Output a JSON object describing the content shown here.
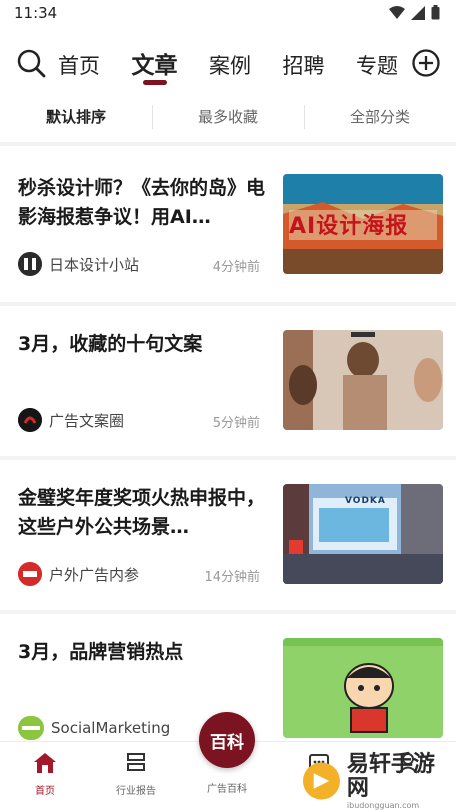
{
  "status": {
    "time": "11:34"
  },
  "nav": {
    "tabs": [
      {
        "label": "首页"
      },
      {
        "label": "文章"
      },
      {
        "label": "案例"
      },
      {
        "label": "招聘"
      },
      {
        "label": "专题"
      }
    ],
    "active_tab": "文章"
  },
  "sort": {
    "options": [
      {
        "label": "默认排序"
      },
      {
        "label": "最多收藏"
      },
      {
        "label": "全部分类"
      }
    ],
    "active": "默认排序"
  },
  "articles": [
    {
      "title": "秒杀设计师？《去你的岛》电影海报惹争议！用AI…",
      "source": "日本设计小站",
      "time": "4分钟前",
      "thumb_text": "AI设计海报"
    },
    {
      "title": "3月，收藏的十句文案",
      "source": "广告文案圈",
      "time": "5分钟前",
      "thumb_text": ""
    },
    {
      "title": "金璧奖年度奖项火热申报中，这些户外公共场景…",
      "source": "户外广告内参",
      "time": "14分钟前",
      "thumb_text": "VODKA"
    },
    {
      "title": "3月，品牌营销热点",
      "source": "SocialMarketing",
      "time": "",
      "thumb_text": ""
    }
  ],
  "bottom_nav": {
    "items": [
      {
        "label": "首页"
      },
      {
        "label": "行业报告"
      },
      {
        "label": "广告百科"
      },
      {
        "label": ""
      },
      {
        "label": ""
      }
    ],
    "center_label": "百科"
  },
  "watermark": {
    "text": "易轩手游网",
    "sub": "ibudongguan.com"
  },
  "colors": {
    "accent": "#7b1420"
  }
}
